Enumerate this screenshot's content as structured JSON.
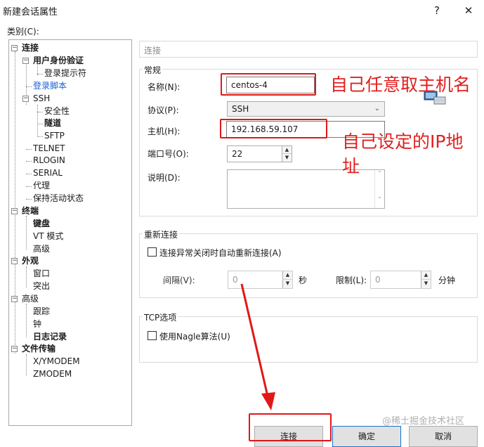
{
  "window": {
    "title": "新建会话属性",
    "help_label": "?",
    "close_label": "✕"
  },
  "category_label": "类别(C):",
  "tree": {
    "connection": "连接",
    "auth": "用户身份验证",
    "login_prompt": "登录提示符",
    "login_script": "登录脚本",
    "ssh": "SSH",
    "security": "安全性",
    "tunnel": "隧道",
    "sftp": "SFTP",
    "telnet": "TELNET",
    "rlogin": "RLOGIN",
    "serial": "SERIAL",
    "proxy": "代理",
    "keepalive": "保持活动状态",
    "terminal": "终端",
    "keyboard": "键盘",
    "vt_mode": "VT 模式",
    "advanced": "高级",
    "appearance": "外观",
    "window": "窗口",
    "highlight": "突出",
    "advanced2": "高级",
    "trace": "跟踪",
    "bell": "钟",
    "logging": "日志记录",
    "file_transfer": "文件传输",
    "xymodem": "X/YMODEM",
    "zmodem": "ZMODEM",
    "expand_glyph": "−"
  },
  "panel": {
    "header": "连接",
    "general": {
      "title": "常规",
      "name_label": "名称(N):",
      "name_value": "centos-4",
      "protocol_label": "协议(P):",
      "protocol_value": "SSH",
      "host_label": "主机(H):",
      "host_value": "192.168.59.107",
      "port_label": "端口号(O):",
      "port_value": "22",
      "desc_label": "说明(D):",
      "desc_value": ""
    },
    "reconnect": {
      "title": "重新连接",
      "checkbox_label": "连接异常关闭时自动重新连接(A)",
      "interval_label": "间隔(V):",
      "interval_value": "0",
      "interval_unit": "秒",
      "limit_label": "限制(L):",
      "limit_value": "0",
      "limit_unit": "分钟"
    },
    "tcp": {
      "title": "TCP选项",
      "nagle_label": "使用Nagle算法(U)"
    }
  },
  "annotations": {
    "name_hint": "自己任意取主机名",
    "ip_hint_line1": "自己设定的IP地",
    "ip_hint_line2": "址"
  },
  "buttons": {
    "connect": "连接",
    "ok": "确定",
    "cancel": "取消"
  },
  "watermark": "@稀土掘金技术社区",
  "colors": {
    "annotation_red": "#e02020",
    "link_blue": "#1a5fd6"
  }
}
